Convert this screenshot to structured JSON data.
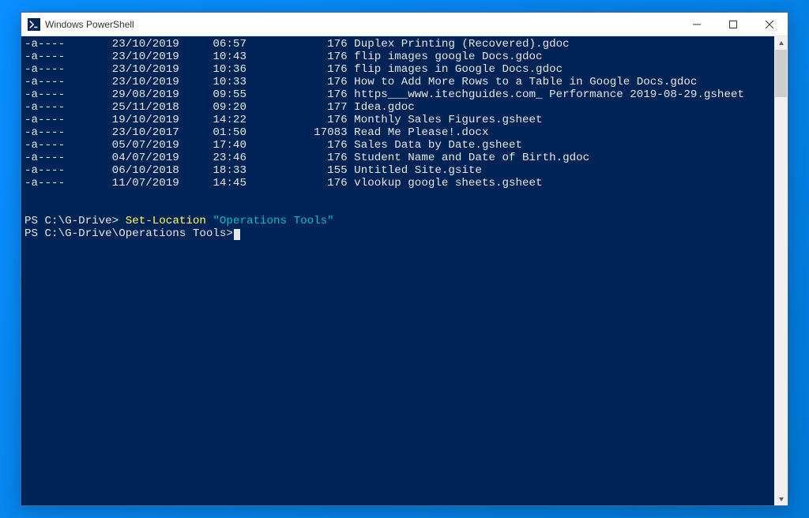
{
  "window": {
    "title": "Windows PowerShell"
  },
  "listing": [
    {
      "mode": "-a----",
      "date": "23/10/2019",
      "time": "06:57",
      "size": "176",
      "name": "Duplex Printing (Recovered).gdoc"
    },
    {
      "mode": "-a----",
      "date": "23/10/2019",
      "time": "10:43",
      "size": "176",
      "name": "flip images google Docs.gdoc"
    },
    {
      "mode": "-a----",
      "date": "23/10/2019",
      "time": "10:36",
      "size": "176",
      "name": "flip images in Google Docs.gdoc"
    },
    {
      "mode": "-a----",
      "date": "23/10/2019",
      "time": "10:33",
      "size": "176",
      "name": "How to Add More Rows to a Table in Google Docs.gdoc"
    },
    {
      "mode": "-a----",
      "date": "29/08/2019",
      "time": "09:55",
      "size": "176",
      "name": "https___www.itechguides.com_ Performance 2019-08-29.gsheet"
    },
    {
      "mode": "-a----",
      "date": "25/11/2018",
      "time": "09:20",
      "size": "177",
      "name": "Idea.gdoc"
    },
    {
      "mode": "-a----",
      "date": "19/10/2019",
      "time": "14:22",
      "size": "176",
      "name": "Monthly Sales Figures.gsheet"
    },
    {
      "mode": "-a----",
      "date": "23/10/2017",
      "time": "01:50",
      "size": "17083",
      "name": "Read Me Please!.docx"
    },
    {
      "mode": "-a----",
      "date": "05/07/2019",
      "time": "17:40",
      "size": "176",
      "name": "Sales Data by Date.gsheet"
    },
    {
      "mode": "-a----",
      "date": "04/07/2019",
      "time": "23:46",
      "size": "176",
      "name": "Student Name and Date of Birth.gdoc"
    },
    {
      "mode": "-a----",
      "date": "06/10/2018",
      "time": "18:33",
      "size": "155",
      "name": "Untitled Site.gsite"
    },
    {
      "mode": "-a----",
      "date": "11/07/2019",
      "time": "14:45",
      "size": "176",
      "name": "vlookup google sheets.gsheet"
    }
  ],
  "prompts": {
    "line1_ps": "PS C:\\G-Drive> ",
    "line1_cmd": "Set-Location",
    "line1_arg": " \"Operations Tools\"",
    "line2_ps": "PS C:\\G-Drive\\Operations Tools>"
  }
}
